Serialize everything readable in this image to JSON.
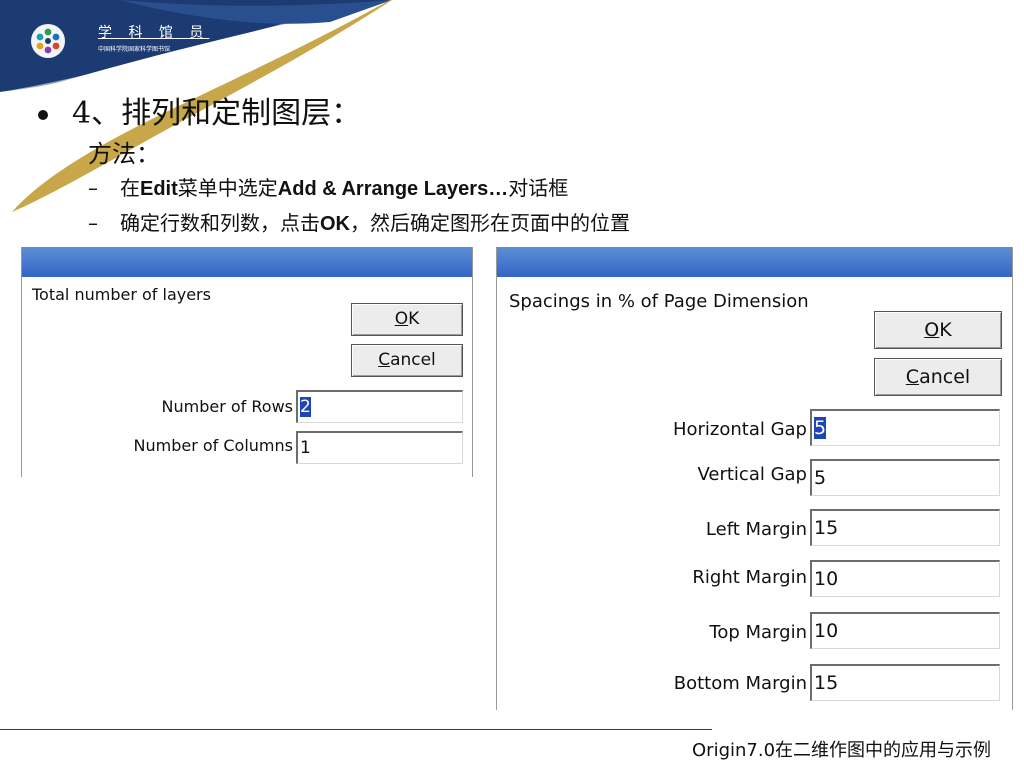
{
  "logo": {
    "main": "学 科 馆 员",
    "sub": "中国科学院国家科学图书馆"
  },
  "slide": {
    "heading": "4、排列和定制图层：",
    "method": "方法：",
    "step1": {
      "pre": "在",
      "b1": "Edit",
      "mid": "菜单中选定",
      "b2": "Add & Arrange Layers…",
      "post": "对话框"
    },
    "step2": {
      "pre": "确定行数和列数，点击",
      "b1": "OK",
      "post": "，然后确定图形在页面中的位置"
    }
  },
  "dialog1": {
    "label": "Total number of layers",
    "ok_label": "O",
    "ok_rest": "K",
    "cancel_label": "C",
    "cancel_rest": "ancel",
    "rows_label": "Number of Rows",
    "rows_value": "2",
    "cols_label": "Number of Columns",
    "cols_value": "1"
  },
  "dialog2": {
    "label": "Spacings in % of Page Dimension",
    "ok_label": "O",
    "ok_rest": "K",
    "cancel_label": "C",
    "cancel_rest": "ancel",
    "fields": [
      {
        "label": "Horizontal Gap",
        "value": "5"
      },
      {
        "label": "Vertical Gap",
        "value": "5"
      },
      {
        "label": "Left Margin",
        "value": "15"
      },
      {
        "label": "Right Margin",
        "value": "10"
      },
      {
        "label": "Top Margin",
        "value": "10"
      },
      {
        "label": "Bottom Margin",
        "value": "15"
      }
    ]
  },
  "footer": {
    "text": "Origin7.0在二维作图中的应用与示例"
  },
  "colors": {
    "navy": "#1c3b73",
    "gold": "#c8a74a",
    "titlebar": "#3a6cc9",
    "selection": "#1e46b6"
  }
}
